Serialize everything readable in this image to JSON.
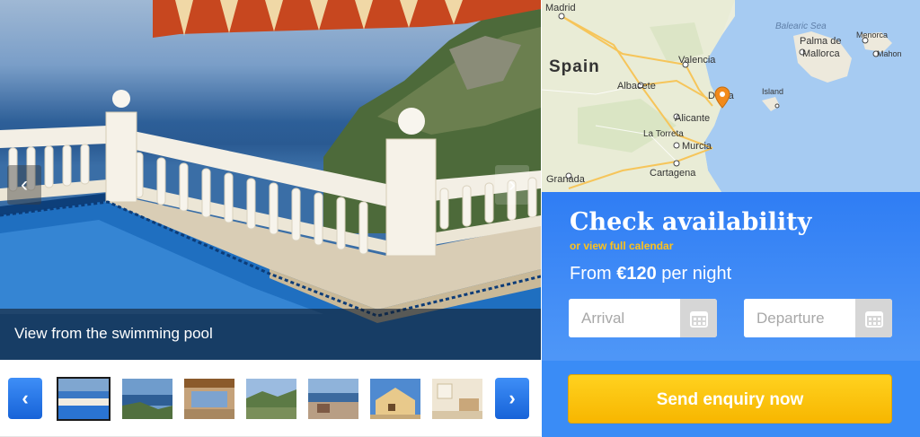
{
  "gallery": {
    "caption": "View from the swimming pool",
    "prev_arrow": "‹",
    "next_arrow": "›",
    "thumbnails": [
      "thumb-1",
      "thumb-2",
      "thumb-3",
      "thumb-4",
      "thumb-5",
      "thumb-6",
      "thumb-7"
    ]
  },
  "map": {
    "labels": {
      "madrid": "Madrid",
      "spain": "Spain",
      "valencia": "Valencia",
      "albacete": "Albacete",
      "denia": "Dénia",
      "alicante": "Alicante",
      "la_torreta": "La Torreta",
      "murcia": "Murcia",
      "granada": "Granada",
      "cartagena": "Cartagena",
      "balearic_sea": "Balearic Sea",
      "palma": "Palma de",
      "mallorca": "Mallorca",
      "menorca": "Menorca",
      "mahon": "Mahon",
      "island": "Island"
    },
    "marker_color": "#f28a1b"
  },
  "booking": {
    "title": "Check availability",
    "calendar_link": "or view full calendar",
    "price_prefix": "From",
    "price": "€120",
    "price_suffix": "per night",
    "arrival_placeholder": "Arrival",
    "departure_placeholder": "Departure",
    "submit_label": "Send enquiry now"
  },
  "colors": {
    "panel_blue": "#2f7df4",
    "button_yellow": "#ffc21a",
    "link_yellow": "#ffc21a"
  }
}
